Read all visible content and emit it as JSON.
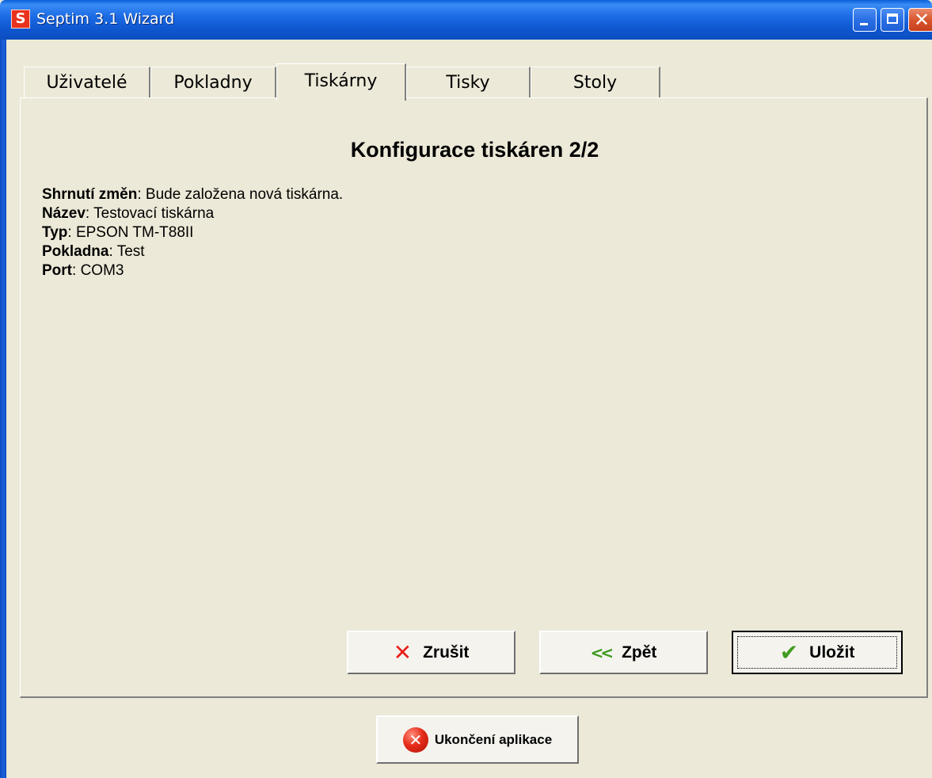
{
  "window": {
    "title": "Septim 3.1 Wizard",
    "icon_letter": "S"
  },
  "tabs": [
    {
      "label": "Uživatelé",
      "active": false
    },
    {
      "label": "Pokladny",
      "active": false
    },
    {
      "label": "Tiskárny",
      "active": true
    },
    {
      "label": "Tisky",
      "active": false
    },
    {
      "label": "Stoly",
      "active": false
    }
  ],
  "panel": {
    "heading": "Konfigurace tiskáren 2/2",
    "summary": [
      {
        "label": "Shrnutí změn",
        "value": "Bude založena nová tiskárna."
      },
      {
        "label": "Název",
        "value": "Testovací tiskárna"
      },
      {
        "label": "Typ",
        "value": "EPSON TM-T88II"
      },
      {
        "label": "Pokladna",
        "value": "Test"
      },
      {
        "label": "Port",
        "value": "COM3"
      }
    ]
  },
  "buttons": {
    "cancel": "Zrušit",
    "back": "Zpět",
    "save": "Uložit",
    "exit": "Ukončení aplikace"
  },
  "icons": {
    "cancel": "x-icon",
    "back": "double-chevron-left-icon",
    "save": "checkmark-icon",
    "exit": "exit-circle-x-icon"
  },
  "colors": {
    "titlebar": "#0f58d1",
    "window_bg": "#ece9d8",
    "cancel_icon": "#e8201c",
    "back_icon": "#3c9a1e",
    "save_icon": "#3f9c22",
    "exit_icon": "#e62c1a"
  }
}
